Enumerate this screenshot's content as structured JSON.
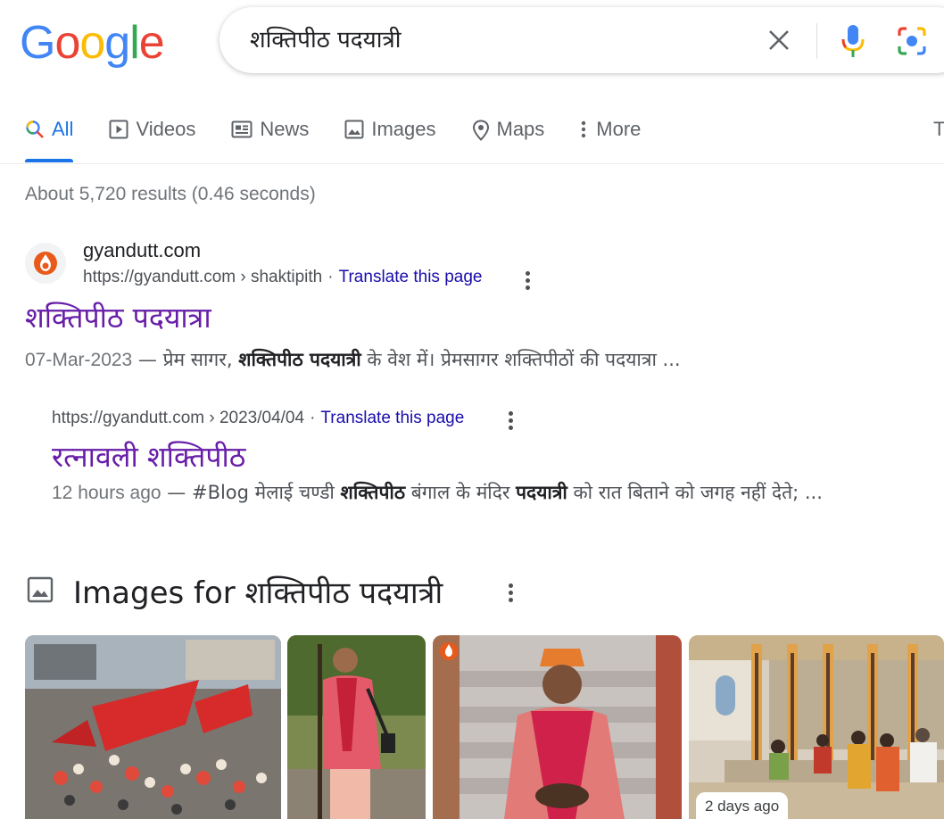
{
  "logo": {
    "letters": [
      "G",
      "o",
      "o",
      "g",
      "l",
      "e"
    ],
    "colors": [
      "#4285f4",
      "#ea4335",
      "#fbbc05",
      "#4285f4",
      "#34a853",
      "#ea4335"
    ]
  },
  "search": {
    "query": "शक्तिपीठ पदयात्री",
    "icons": [
      "close-icon",
      "mic-icon",
      "lens-icon"
    ]
  },
  "tabs": [
    {
      "label": "All",
      "icon": "search-icon",
      "active": true
    },
    {
      "label": "Videos",
      "icon": "play-icon"
    },
    {
      "label": "News",
      "icon": "news-icon"
    },
    {
      "label": "Images",
      "icon": "image-icon"
    },
    {
      "label": "Maps",
      "icon": "map-pin-icon"
    },
    {
      "label": "More",
      "icon": "more-vert-icon"
    }
  ],
  "tools_label": "T",
  "result_stats": "About 5,720 results (0.46 seconds)",
  "result1": {
    "site_name": "gyandutt.com",
    "url": "https://gyandutt.com › shaktipith",
    "separator": "·",
    "translate": "Translate this page",
    "title": "शक्तिपीठ पदयात्रा",
    "snippet": {
      "date": "07-Mar-2023",
      "dash": " — ",
      "part1": "प्रेम सागर, ",
      "bold1": "शक्तिपीठ पदयात्री",
      "part2": " के वेश में। प्रेमसागर शक्तिपीठों की पदयात्रा ..."
    }
  },
  "result2": {
    "url": "https://gyandutt.com › 2023/04/04",
    "separator": "·",
    "translate": "Translate this page",
    "title": "रत्नावली शक्तिपीठ",
    "snippet": {
      "date": "12 hours ago",
      "dash": " — ",
      "part1": "#Blog मेलाई चण्डी ",
      "bold1": "शक्तिपीठ",
      "part2": " बंगाल के मंदिर ",
      "bold2": "पदयात्री",
      "part3": " को रात बिताने को जगह नहीं देते; ..."
    }
  },
  "images_section": {
    "title": "Images for शक्तिपीठ पदयात्री",
    "badge": "2 days ago"
  },
  "colors": {
    "accent": "#1a73e8",
    "visited": "#681da8",
    "link": "#1a0dab"
  }
}
